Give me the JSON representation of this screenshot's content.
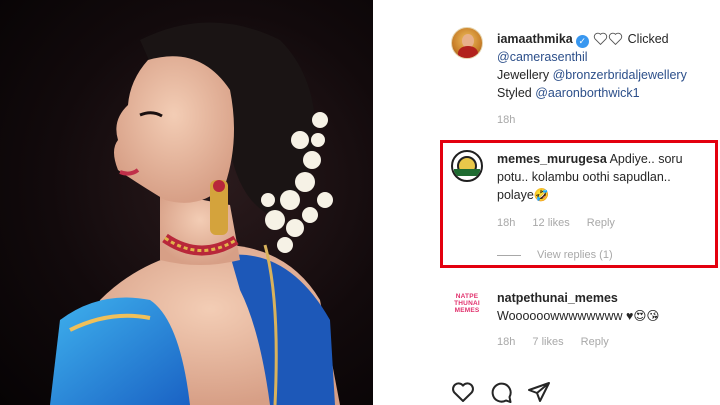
{
  "post": {
    "author": "iamaathmika",
    "caption_suffix": "Clicked",
    "caption_lines": [
      {
        "prefix": "",
        "link": "@camerasenthil"
      },
      {
        "prefix": "Jewellery ",
        "link": "@bronzerbridaljewellery"
      },
      {
        "prefix": "Styled ",
        "link": "@aaronborthwick1"
      }
    ],
    "time": "18h"
  },
  "comments": [
    {
      "username": "memes_murugesa",
      "text": "Apdiye.. soru potu.. kolambu oothi sapudlan.. polaye🤣",
      "time": "18h",
      "likes": "12 likes",
      "reply_label": "Reply",
      "view_replies": "View replies (1)"
    },
    {
      "username": "natpethunai_memes",
      "avatar_text": [
        "NATPE",
        "THUNAI",
        "MEMES"
      ],
      "text": "Woooooowwwwwwww ♥😍😘",
      "time": "18h",
      "likes": "7 likes",
      "reply_label": "Reply"
    }
  ],
  "actions": {
    "icons": [
      "heart-icon",
      "comment-icon",
      "share-icon"
    ]
  },
  "colors": {
    "link": "#2c4f8a",
    "highlight": "#e3000f",
    "verified": "#3897f0"
  }
}
